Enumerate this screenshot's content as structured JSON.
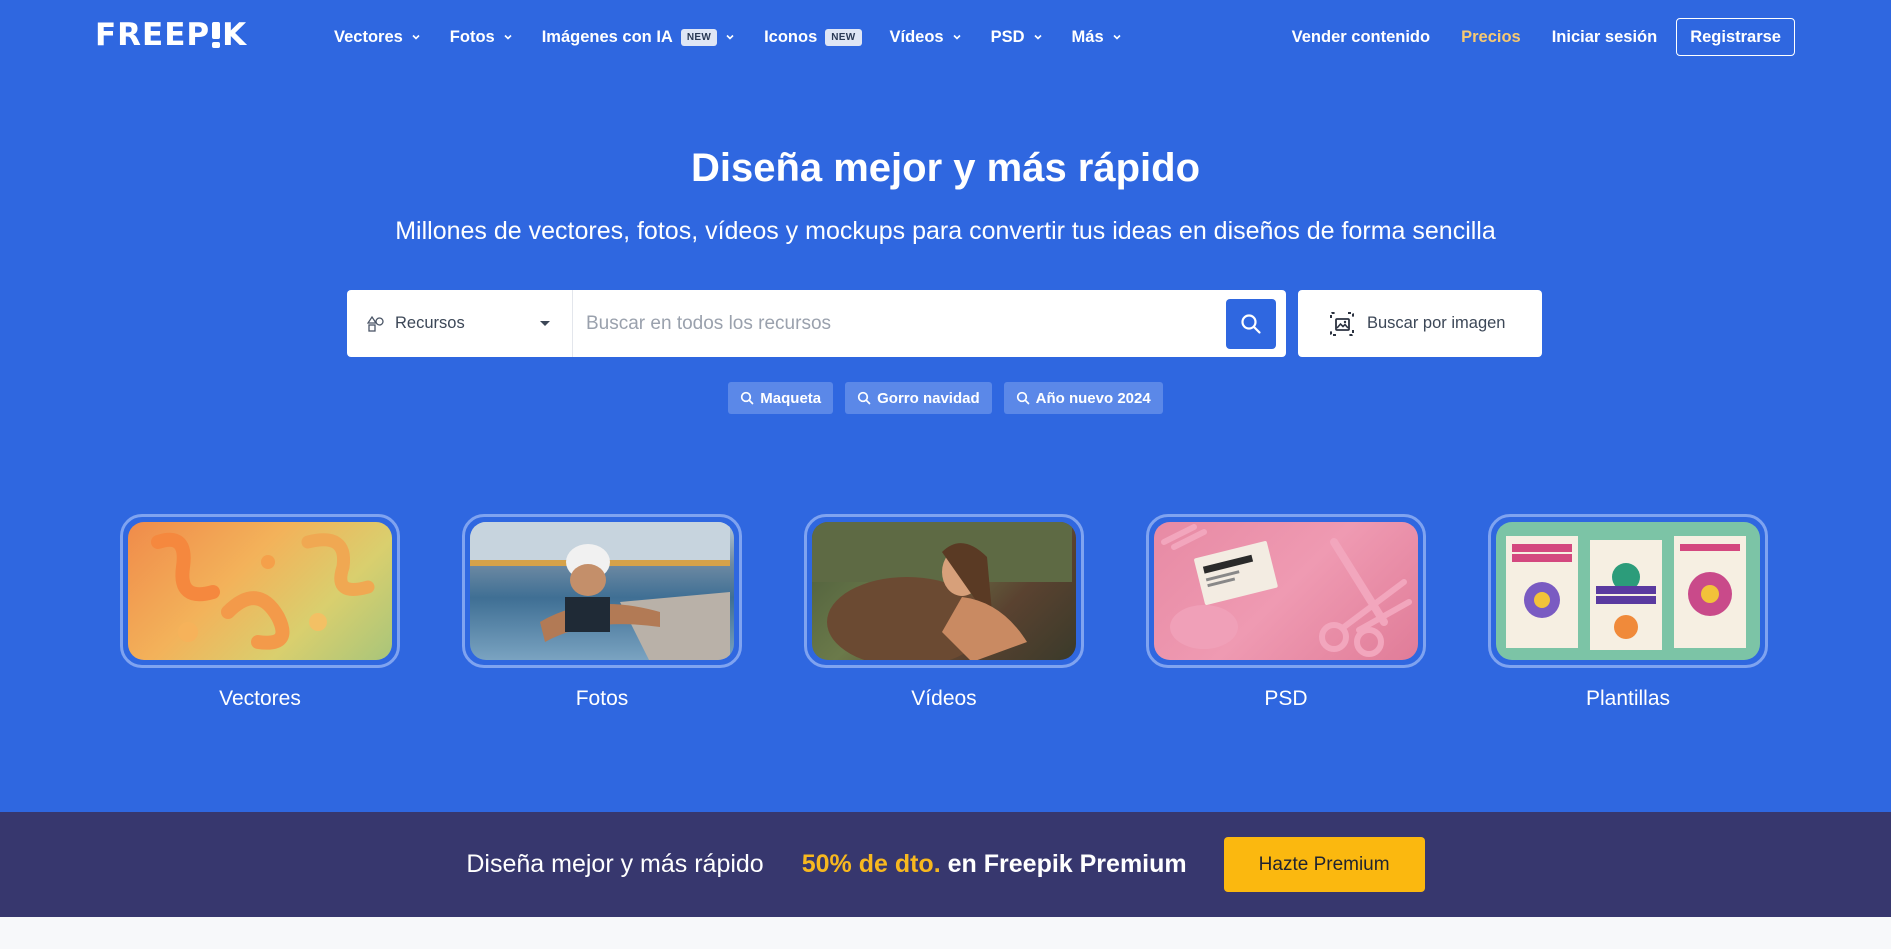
{
  "logo": {
    "text_before": "FREEP",
    "text_after": "K"
  },
  "nav": {
    "items": [
      {
        "label": "Vectores",
        "has_chevron": true
      },
      {
        "label": "Fotos",
        "has_chevron": true
      },
      {
        "label": "Imágenes con IA",
        "badge": "NEW",
        "has_chevron": true
      },
      {
        "label": "Iconos",
        "badge": "NEW",
        "has_chevron": false
      },
      {
        "label": "Vídeos",
        "has_chevron": true
      },
      {
        "label": "PSD",
        "has_chevron": true
      },
      {
        "label": "Más",
        "has_chevron": true
      }
    ],
    "sell": "Vender contenido",
    "pricing": "Precios",
    "login": "Iniciar sesión",
    "register": "Registrarse"
  },
  "hero": {
    "title": "Diseña mejor y más rápido",
    "subtitle": "Millones de vectores, fotos, vídeos y mockups para convertir tus ideas en diseños de forma sencilla"
  },
  "search": {
    "resource_type": "Recursos",
    "placeholder": "Buscar en todos los recursos",
    "image_search": "Buscar por imagen"
  },
  "tags": [
    "Maqueta",
    "Gorro navidad",
    "Año nuevo 2024"
  ],
  "categories": [
    {
      "label": "Vectores"
    },
    {
      "label": "Fotos"
    },
    {
      "label": "Vídeos"
    },
    {
      "label": "PSD"
    },
    {
      "label": "Plantillas"
    }
  ],
  "promo": {
    "text": "Diseña mejor y más rápido",
    "discount": "50% de dto.",
    "product": "en Freepik Premium",
    "cta": "Hazte Premium"
  },
  "colors": {
    "hero_bg": "#2f67e0",
    "promo_bg": "#37376e",
    "accent_yellow": "#fbb80f",
    "pricing": "#f7c971"
  }
}
